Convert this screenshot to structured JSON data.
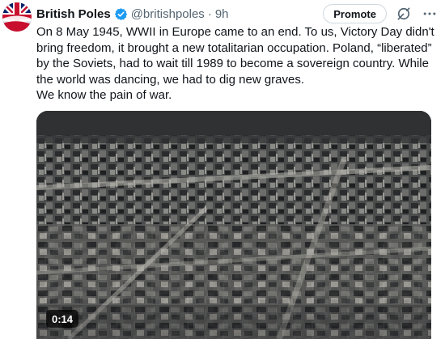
{
  "tweet": {
    "display_name": "British Poles",
    "handle": "@britishpoles",
    "separator": "·",
    "time": "9h",
    "text": "On 8 May 1945, WWII in Europe came to an end. To us, Victory Day didn't\nbring freedom, it brought a new totalitarian occupation. Poland, “liberated”\nby the Soviets, had to wait till 1989 to become a sovereign country. While\nthe world was dancing, we had to dig new graves.\nWe know the pain of war."
  },
  "actions": {
    "promote_label": "Promote"
  },
  "media": {
    "duration": "0:14"
  },
  "colors": {
    "verified": "#1d9bf0",
    "muted_text": "#536471",
    "avatar_red": "#c8102e",
    "avatar_white": "#ffffff",
    "avatar_blue": "#012169"
  }
}
